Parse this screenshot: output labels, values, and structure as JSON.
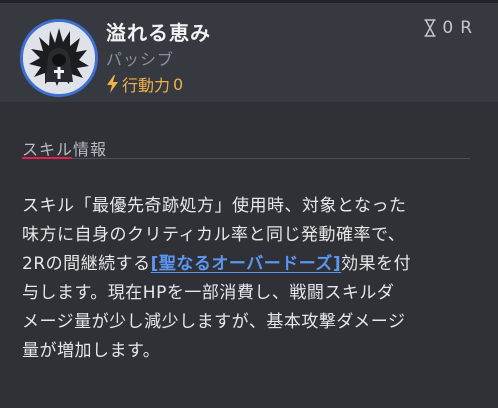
{
  "skill": {
    "name": "溢れる恵み",
    "type": "パッシブ",
    "action_cost_label": "行動力",
    "action_cost_value": "0",
    "cooldown": "0",
    "cooldown_unit": "R",
    "avatar_icon": "cross-flame-icon"
  },
  "section": {
    "title": "スキル情報"
  },
  "description": {
    "line1": "スキル「最優先奇跡処方」使用時、対象となった",
    "line2": "味方に自身のクリティカル率と同じ発動確率で、",
    "line3_prefix": "2Rの間継続する",
    "line3_link": "[聖なるオーバードーズ]",
    "line3_suffix": "効果を付",
    "line4": "与します。現在HPを一部消費し、戦闘スキルダ",
    "line5": "メージ量が少し減少しますが、基本攻撃ダメージ",
    "line6": "量が増加します。"
  },
  "colors": {
    "accent_link": "#5b96f3",
    "action_cost": "#f0b24a",
    "section_underline": "#e0214f",
    "avatar_ring": "#3f6fd3"
  }
}
